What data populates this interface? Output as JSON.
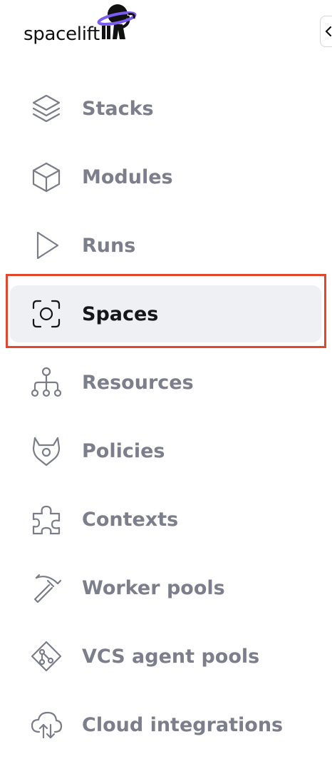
{
  "brand": {
    "name": "spacelift",
    "accent_color": "#7b5cf0",
    "highlight_color": "#e2462c"
  },
  "nav": {
    "items": [
      {
        "label": "Stacks",
        "icon": "layers-icon",
        "active": false
      },
      {
        "label": "Modules",
        "icon": "cube-icon",
        "active": false
      },
      {
        "label": "Runs",
        "icon": "play-icon",
        "active": false
      },
      {
        "label": "Spaces",
        "icon": "focus-circle-icon",
        "active": true
      },
      {
        "label": "Resources",
        "icon": "hierarchy-icon",
        "active": false
      },
      {
        "label": "Policies",
        "icon": "shield-horned-icon",
        "active": false
      },
      {
        "label": "Contexts",
        "icon": "puzzle-icon",
        "active": false
      },
      {
        "label": "Worker pools",
        "icon": "pickaxe-icon",
        "active": false
      },
      {
        "label": "VCS agent pools",
        "icon": "git-diamond-icon",
        "active": false
      },
      {
        "label": "Cloud integrations",
        "icon": "cloud-sync-icon",
        "active": false
      }
    ]
  }
}
